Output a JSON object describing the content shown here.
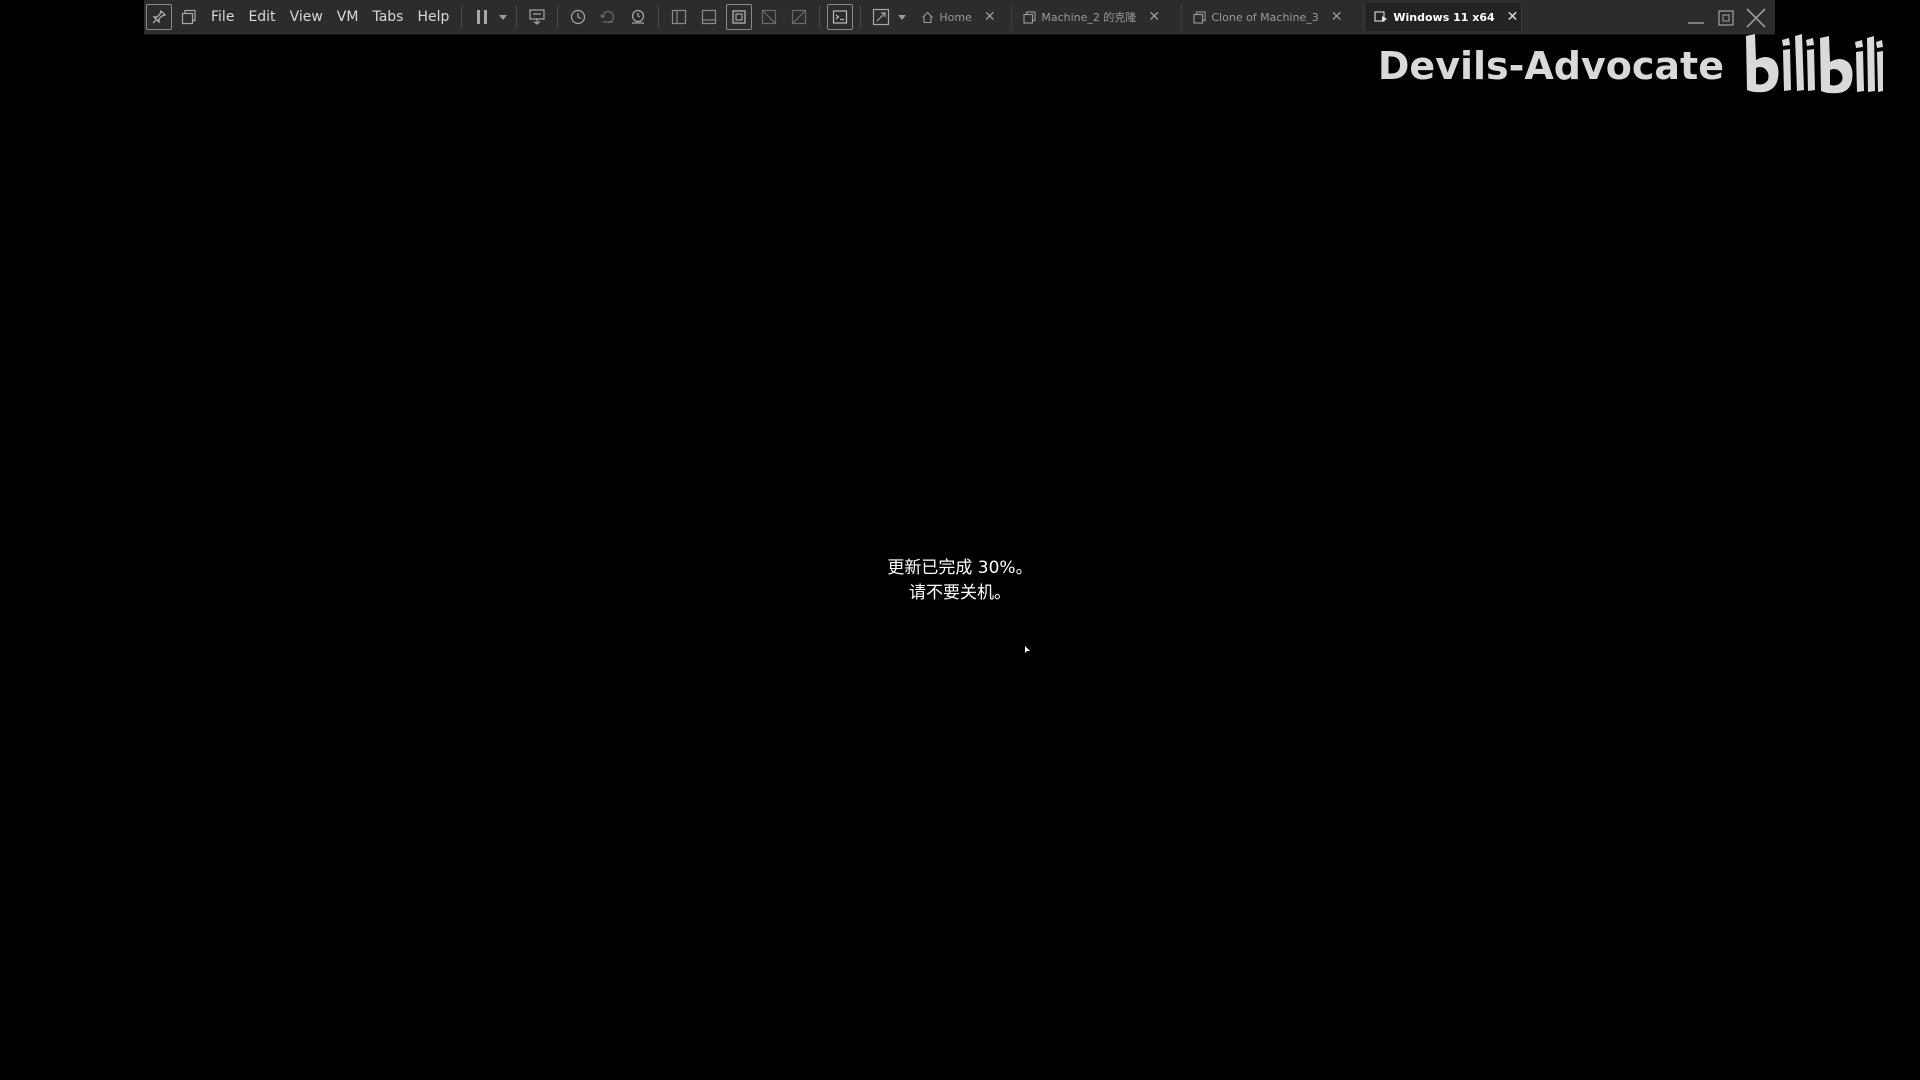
{
  "toolbar": {
    "menu": [
      {
        "label": "File"
      },
      {
        "label": "Edit"
      },
      {
        "label": "View"
      },
      {
        "label": "VM"
      },
      {
        "label": "Tabs"
      },
      {
        "label": "Help"
      }
    ],
    "icons": [
      "pin-icon",
      "library-icon",
      "pause-icon",
      "send-ctrl-alt-del-icon",
      "snapshot-take-icon",
      "snapshot-revert-icon",
      "snapshot-manager-icon",
      "show-sidebar-icon",
      "show-thumbnail-bar-icon",
      "fit-guest-icon",
      "stretch-guest-icon",
      "autofit-guest-icon",
      "console-view-icon",
      "full-screen-icon"
    ]
  },
  "tabs": [
    {
      "label": "Home",
      "icon": "home-icon",
      "active": false
    },
    {
      "label": "Machine_2 的克隆",
      "icon": "vm-tab-icon",
      "active": false
    },
    {
      "label": "Clone of Machine_3",
      "icon": "vm-tab-icon",
      "active": false
    },
    {
      "label": "Windows 11 x64",
      "icon": "vm-running-tab-icon",
      "active": true
    }
  ],
  "window_controls": [
    "minimize-icon",
    "restore-icon",
    "close-icon"
  ],
  "watermark": {
    "text": "Devils-Advocate",
    "logo": "bilibili"
  },
  "update": {
    "line1": "更新已完成 30%。",
    "line2": "请不要关机。",
    "percent": 30
  },
  "colors": {
    "background": "#000000",
    "toolbar": "#2c2c2c",
    "active_tab": "#232323",
    "text": "#ffffff"
  }
}
